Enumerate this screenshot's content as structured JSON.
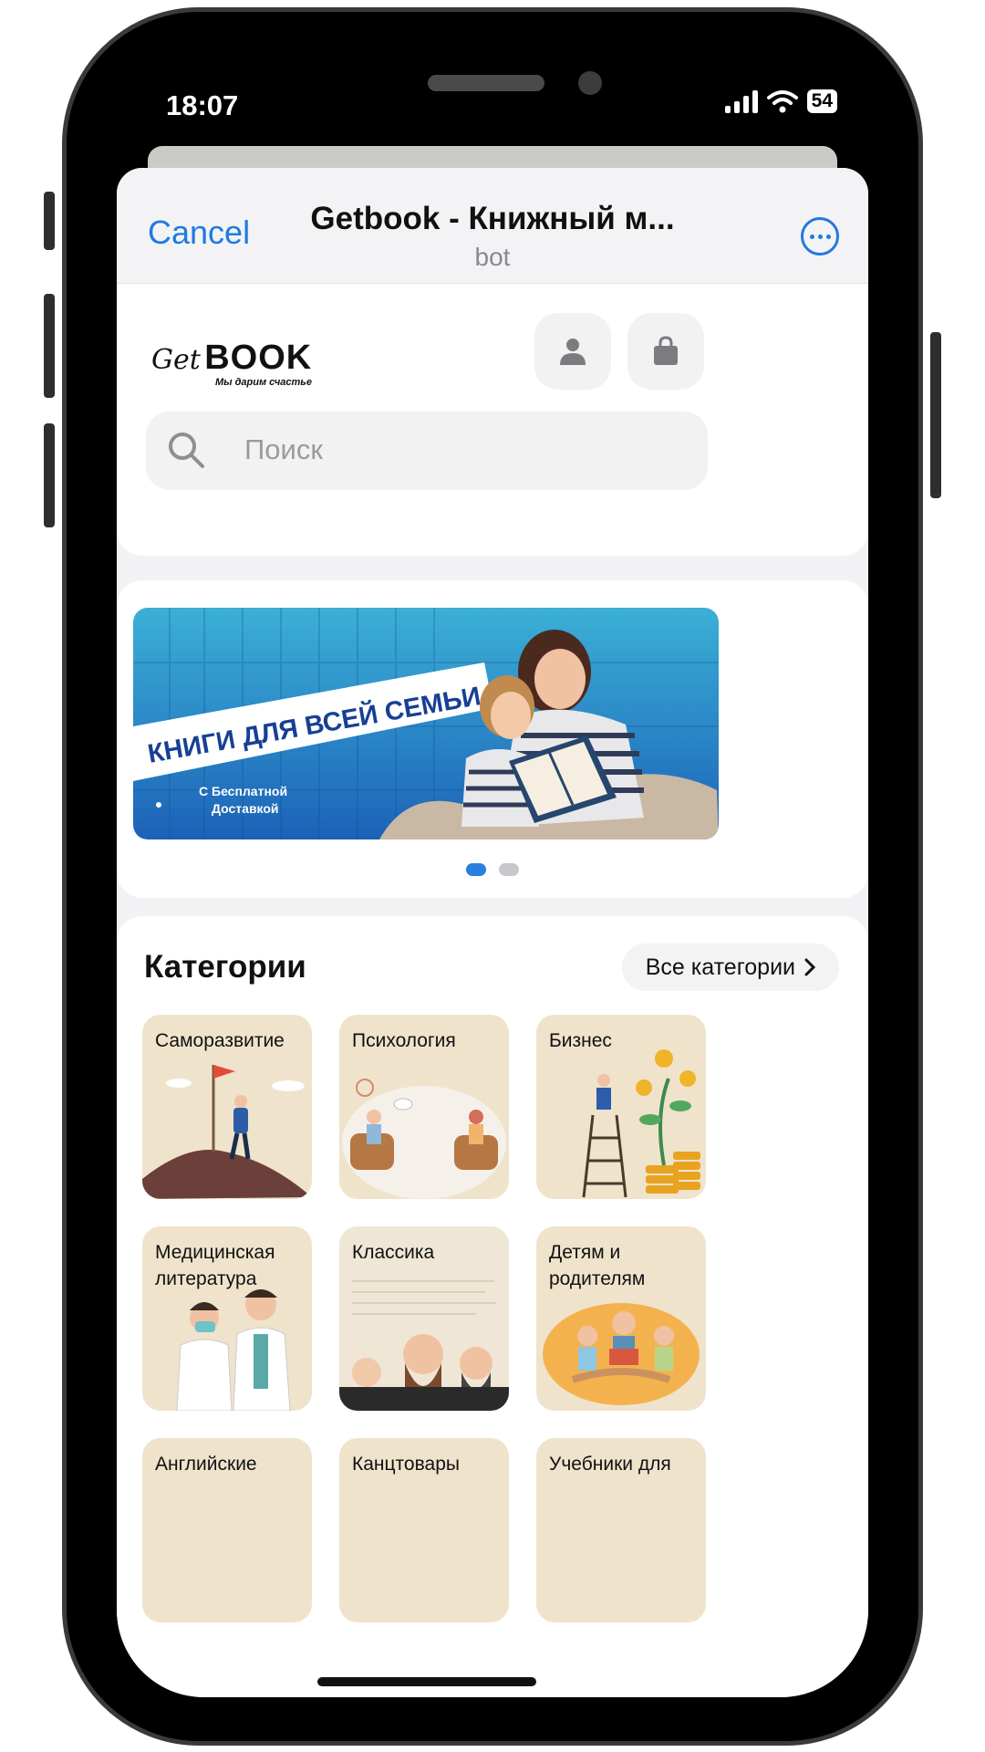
{
  "status": {
    "time": "18:07",
    "battery": "54"
  },
  "header": {
    "cancel": "Cancel",
    "title": "Getbook - Книжный м...",
    "subtitle": "bot"
  },
  "brand": {
    "get": "Get",
    "book": "BOOK",
    "tagline": "Мы дарим счастье"
  },
  "search": {
    "placeholder": "Поиск"
  },
  "banner": {
    "headline": "КНИГИ ДЛЯ ВСЕЙ СЕМЬИ",
    "line1": "С Бесплатной",
    "line2": "Доставкой",
    "slides": 2,
    "active_slide": 1
  },
  "categories": {
    "title": "Категории",
    "all_label": "Все категории",
    "items": [
      "Саморазвитие",
      "Психология",
      "Бизнес",
      "Медицинская литература",
      "Классика",
      "Детям и родителям",
      "Английские",
      "Канцтовары",
      "Учебники для"
    ]
  },
  "colors": {
    "accent": "#1f7ae0",
    "tile_bg": "#efe3cc",
    "banner_blue": "#1a6fc0"
  },
  "icons": [
    "search-icon",
    "user-icon",
    "cart-icon",
    "more-icon",
    "chevron-right-icon"
  ]
}
